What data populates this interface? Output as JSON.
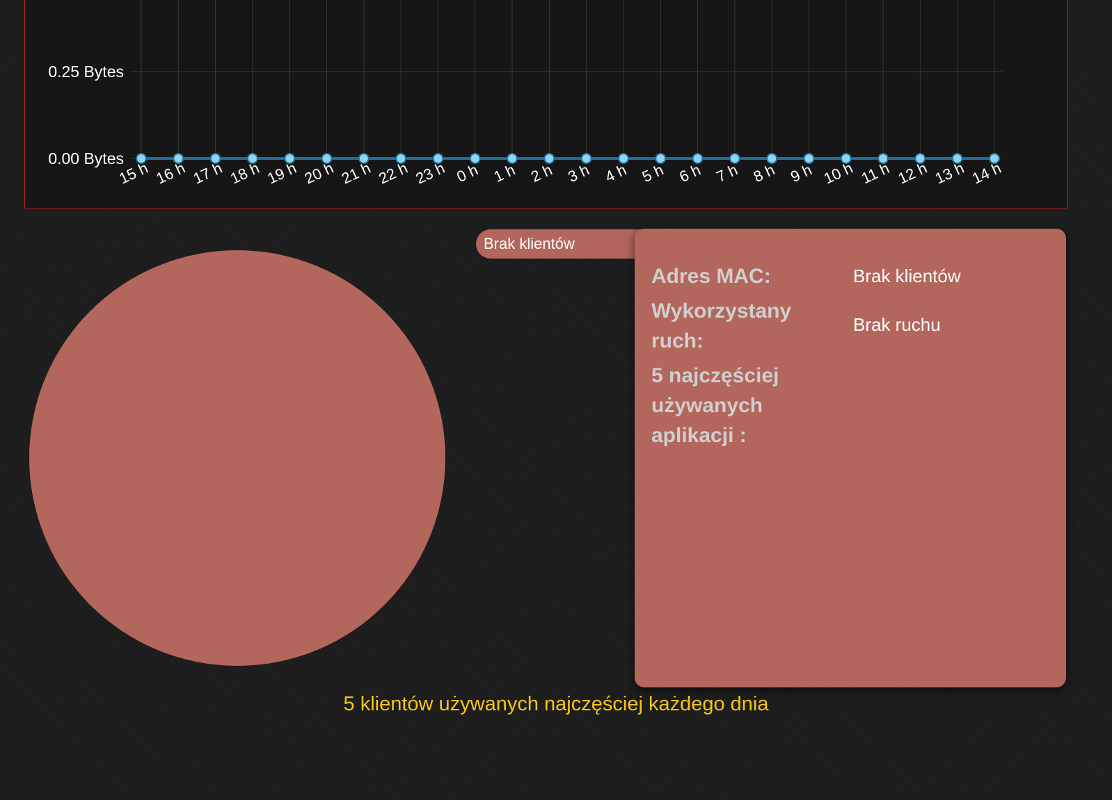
{
  "chart_data": {
    "type": "line",
    "x": [
      "15 h",
      "16 h",
      "17 h",
      "18 h",
      "19 h",
      "20 h",
      "21 h",
      "22 h",
      "23 h",
      "0 h",
      "1 h",
      "2 h",
      "3 h",
      "4 h",
      "5 h",
      "6 h",
      "7 h",
      "8 h",
      "9 h",
      "10 h",
      "11 h",
      "12 h",
      "13 h",
      "14 h"
    ],
    "series": [
      {
        "values": [
          0,
          0,
          0,
          0,
          0,
          0,
          0,
          0,
          0,
          0,
          0,
          0,
          0,
          0,
          0,
          0,
          0,
          0,
          0,
          0,
          0,
          0,
          0,
          0
        ]
      }
    ],
    "y_ticks": [
      {
        "value": 0.25,
        "label": "0.25 Bytes"
      },
      {
        "value": 0,
        "label": "0.00 Bytes"
      }
    ],
    "grid": true,
    "colors": {
      "line": "#1d6f96",
      "point_fill": "#8fd3f5",
      "grid": "#2f3a40"
    }
  },
  "client_tab": {
    "label": "Brak klientów"
  },
  "details": {
    "mac": {
      "label": "Adres MAC:",
      "value": "Brak klientów"
    },
    "traffic": {
      "label": "Wykorzystany ruch:",
      "value": "Brak ruchu"
    },
    "top_apps": {
      "label": "5 najczęściej używanych aplikacji :"
    }
  },
  "footer": {
    "caption": "5 klientów używanych najczęściej każdego dnia"
  },
  "colors": {
    "accent": "#b3665c",
    "border": "#b3222a",
    "caption": "#f5c518"
  }
}
